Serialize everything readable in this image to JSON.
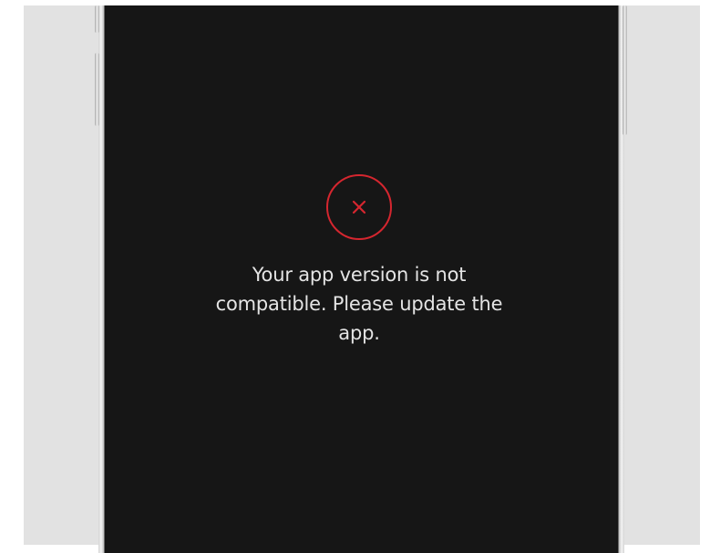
{
  "error_screen": {
    "icon": "close-circle-icon",
    "message": "Your app version is not compatible. Please update the app."
  },
  "colors": {
    "screen_background": "#161616",
    "error_accent": "#d5262f",
    "message_text": "#e4e4e4"
  }
}
